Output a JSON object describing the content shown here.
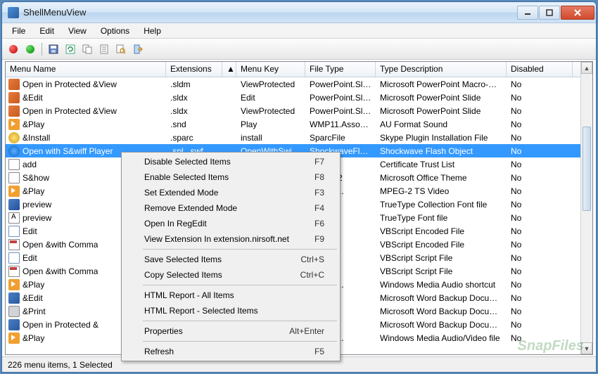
{
  "window": {
    "title": "ShellMenuView"
  },
  "menubar": [
    "File",
    "Edit",
    "View",
    "Options",
    "Help"
  ],
  "columns": {
    "name": "Menu Name",
    "ext": "Extensions",
    "sort_indicator": "▲",
    "key": "Menu Key",
    "type": "File Type",
    "desc": "Type Description",
    "dis": "Disabled"
  },
  "rows": [
    {
      "icon": "ico-ppt",
      "name": "Open in Protected &View",
      "ext": ".sldm",
      "key": "ViewProtected",
      "type": "PowerPoint.Sli...",
      "desc": "Microsoft PowerPoint Macro-En...",
      "dis": "No",
      "selected": false
    },
    {
      "icon": "ico-ppt",
      "name": "&Edit",
      "ext": ".sldx",
      "key": "Edit",
      "type": "PowerPoint.Sli...",
      "desc": "Microsoft PowerPoint Slide",
      "dis": "No",
      "selected": false
    },
    {
      "icon": "ico-ppt",
      "name": "Open in Protected &View",
      "ext": ".sldx",
      "key": "ViewProtected",
      "type": "PowerPoint.Sli...",
      "desc": "Microsoft PowerPoint Slide",
      "dis": "No",
      "selected": false
    },
    {
      "icon": "ico-play",
      "name": "&Play",
      "ext": ".snd",
      "key": "Play",
      "type": "WMP11.AssocFil...",
      "desc": "AU Format Sound",
      "dis": "No",
      "selected": false
    },
    {
      "icon": "ico-gear",
      "name": "&Install",
      "ext": ".sparc",
      "key": "install",
      "type": "SparcFile",
      "desc": "Skype Plugin Installation File",
      "dis": "No",
      "selected": false
    },
    {
      "icon": "ico-swf",
      "name": "Open with S&wiff Player",
      "ext": ".spl, .swf",
      "key": "OpenWithSwif...",
      "type": "ShockwaveFlas...",
      "desc": "Shockwave Flash Object",
      "dis": "No",
      "selected": true
    },
    {
      "icon": "ico-doc",
      "name": "add",
      "ext": "",
      "key": "",
      "type": "",
      "desc": "Certificate Trust List",
      "dis": "No",
      "selected": false
    },
    {
      "icon": "ico-doc",
      "name": "S&how",
      "ext": "",
      "key": "",
      "type": "heme.12",
      "desc": "Microsoft Office Theme",
      "dis": "No",
      "selected": false
    },
    {
      "icon": "ico-play",
      "name": "&Play",
      "ext": "",
      "key": "",
      "type": "l.Assoc...",
      "desc": "MPEG-2 TS Video",
      "dis": "No",
      "selected": false
    },
    {
      "icon": "ico-font",
      "name": "preview",
      "ext": "",
      "key": "",
      "type": "",
      "desc": "TrueType Collection Font file",
      "dis": "No",
      "selected": false
    },
    {
      "icon": "ico-font2",
      "name": "preview",
      "ext": "",
      "key": "",
      "type": "",
      "desc": "TrueType Font file",
      "dis": "No",
      "selected": false
    },
    {
      "icon": "ico-edit",
      "name": "Edit",
      "ext": "",
      "key": "",
      "type": "",
      "desc": "VBScript Encoded File",
      "dis": "No",
      "selected": false
    },
    {
      "icon": "ico-cmd",
      "name": "Open &with Comma",
      "ext": "",
      "key": "",
      "type": "",
      "desc": "VBScript Encoded File",
      "dis": "No",
      "selected": false
    },
    {
      "icon": "ico-edit",
      "name": "Edit",
      "ext": "",
      "key": "",
      "type": "",
      "desc": "VBScript Script File",
      "dis": "No",
      "selected": false
    },
    {
      "icon": "ico-cmd",
      "name": "Open &with Comma",
      "ext": "",
      "key": "",
      "type": "",
      "desc": "VBScript Script File",
      "dis": "No",
      "selected": false
    },
    {
      "icon": "ico-play",
      "name": "&Play",
      "ext": "",
      "key": "",
      "type": "l.Assoc...",
      "desc": "Windows Media Audio shortcut",
      "dis": "No",
      "selected": false
    },
    {
      "icon": "ico-word",
      "name": "&Edit",
      "ext": "",
      "key": "",
      "type": "ackup.8",
      "desc": "Microsoft Word Backup Docum...",
      "dis": "No",
      "selected": false
    },
    {
      "icon": "ico-print",
      "name": "&Print",
      "ext": "",
      "key": "",
      "type": "ackup.8",
      "desc": "Microsoft Word Backup Docum...",
      "dis": "No",
      "selected": false
    },
    {
      "icon": "ico-word",
      "name": "Open in Protected &",
      "ext": "",
      "key": "",
      "type": "ackup.8",
      "desc": "Microsoft Word Backup Docum...",
      "dis": "No",
      "selected": false
    },
    {
      "icon": "ico-play",
      "name": "&Play",
      "ext": "",
      "key": "",
      "type": "l.Assoc...",
      "desc": "Windows Media Audio/Video file",
      "dis": "No",
      "selected": false
    }
  ],
  "context_menu": [
    {
      "type": "item",
      "label": "Disable Selected Items",
      "shortcut": "F7"
    },
    {
      "type": "item",
      "label": "Enable Selected Items",
      "shortcut": "F8"
    },
    {
      "type": "item",
      "label": "Set Extended Mode",
      "shortcut": "F3"
    },
    {
      "type": "item",
      "label": "Remove Extended Mode",
      "shortcut": "F4"
    },
    {
      "type": "item",
      "label": "Open In RegEdit",
      "shortcut": "F6"
    },
    {
      "type": "item",
      "label": "View Extension In extension.nirsoft.net",
      "shortcut": "F9"
    },
    {
      "type": "sep"
    },
    {
      "type": "item",
      "label": "Save Selected Items",
      "shortcut": "Ctrl+S"
    },
    {
      "type": "item",
      "label": "Copy Selected Items",
      "shortcut": "Ctrl+C"
    },
    {
      "type": "sep"
    },
    {
      "type": "item",
      "label": "HTML Report - All Items",
      "shortcut": ""
    },
    {
      "type": "item",
      "label": "HTML Report - Selected Items",
      "shortcut": ""
    },
    {
      "type": "sep"
    },
    {
      "type": "item",
      "label": "Properties",
      "shortcut": "Alt+Enter"
    },
    {
      "type": "sep"
    },
    {
      "type": "item",
      "label": "Refresh",
      "shortcut": "F5"
    }
  ],
  "statusbar": "226 menu items, 1 Selected",
  "watermark": "SnapFiles"
}
